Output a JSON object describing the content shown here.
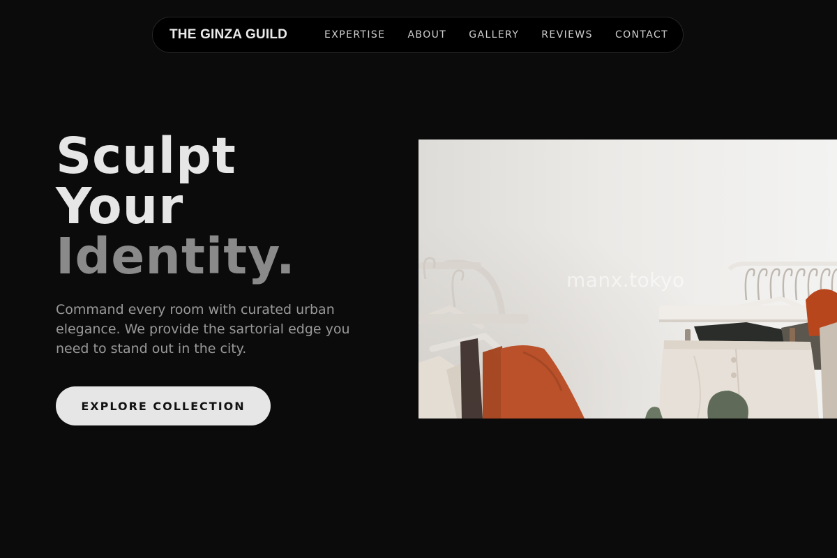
{
  "nav": {
    "brand": "THE GINZA GUILD",
    "links": [
      "EXPERTISE",
      "ABOUT",
      "GALLERY",
      "REVIEWS",
      "CONTACT"
    ]
  },
  "hero": {
    "title_line1": "Sculpt",
    "title_line2": "Your",
    "title_line3": "Identity.",
    "subtitle": "Command every room with curated urban elegance. We provide the sartorial edge you need to stand out in the city.",
    "cta_label": "EXPLORE COLLECTION"
  },
  "image": {
    "subject": "clothing-rack-photo",
    "watermark": "manx.tokyo"
  },
  "colors": {
    "background": "#0b0b0b",
    "nav_background": "#000000",
    "text_primary": "#e6e6e6",
    "text_muted": "#8a8a8a",
    "cta_background": "#e6e6e6",
    "garment_accent": "#b8461c"
  }
}
